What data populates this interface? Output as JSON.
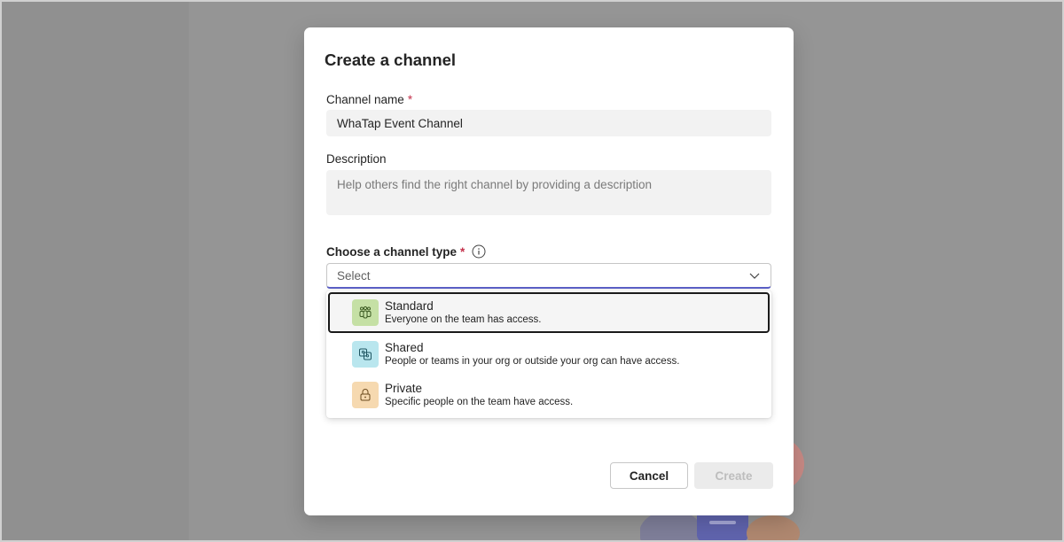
{
  "dialog": {
    "title": "Create a channel",
    "channel_name_label": "Channel name",
    "required_marker": "*",
    "channel_name_value": "WhaTap Event Channel",
    "description_label": "Description",
    "description_placeholder": "Help others find the right channel by providing a description",
    "channel_type_label": "Choose a channel type",
    "select_placeholder": "Select",
    "options": [
      {
        "title": "Standard",
        "desc": "Everyone on the team has access.",
        "icon": "team-icon",
        "color": "#c5e0a5"
      },
      {
        "title": "Shared",
        "desc": "People or teams in your org or outside your org can have access.",
        "icon": "shared-icon",
        "color": "#b9e6ee"
      },
      {
        "title": "Private",
        "desc": "Specific people on the team have access.",
        "icon": "lock-icon",
        "color": "#f6d9b0"
      }
    ],
    "cancel_label": "Cancel",
    "create_label": "Create"
  },
  "colors": {
    "accent": "#5b5fc7",
    "required": "#c4314b"
  }
}
